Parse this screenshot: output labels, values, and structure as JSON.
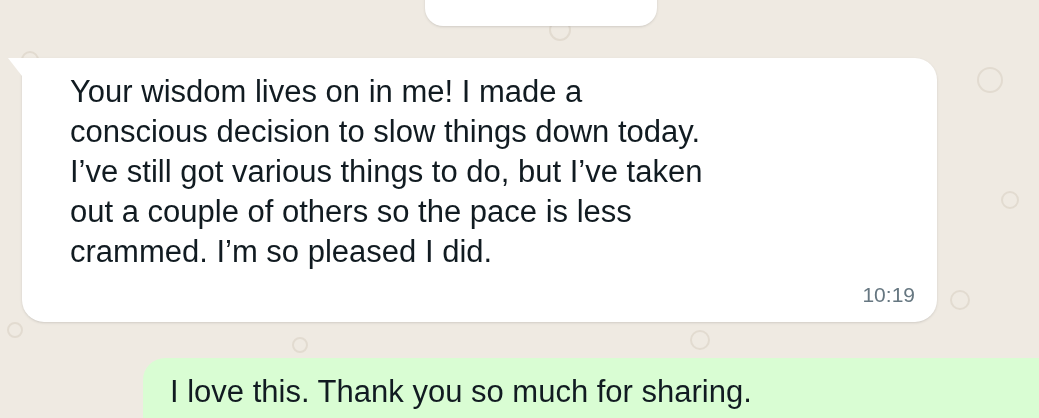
{
  "messages": [
    {
      "kind": "incoming",
      "text": "Your wisdom lives on in me! I made a\nconscious decision to slow things down today.\nI’ve still got various things to do, but I’ve taken\nout a couple of others so the pace is less\ncrammed. I’m so pleased I did.",
      "time": "10:19"
    },
    {
      "kind": "outgoing",
      "text": "I love this. Thank you so much for sharing."
    }
  ]
}
